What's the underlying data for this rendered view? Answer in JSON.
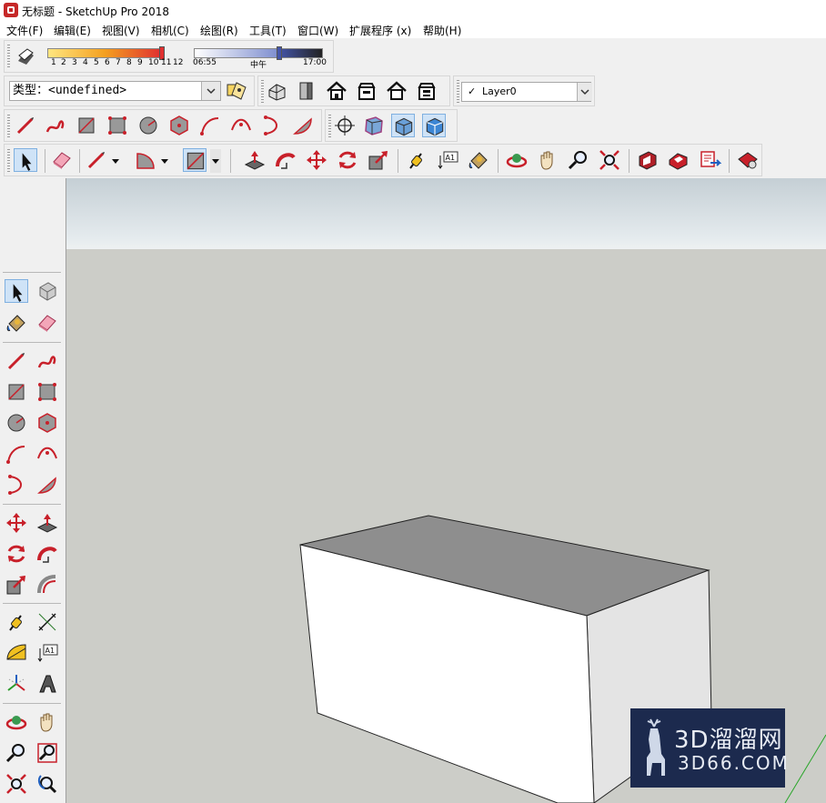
{
  "window": {
    "title": "无标题 - SketchUp Pro 2018"
  },
  "menu": [
    "文件(F)",
    "编辑(E)",
    "视图(V)",
    "相机(C)",
    "绘图(R)",
    "工具(T)",
    "窗口(W)",
    "扩展程序 (x)",
    "帮助(H)"
  ],
  "shadows": {
    "month_ticks": [
      "1",
      "2",
      "3",
      "4",
      "5",
      "6",
      "7",
      "8",
      "9",
      "10",
      "11",
      "12"
    ],
    "time_start": "06:55",
    "time_mid": "中午",
    "time_end": "17:00",
    "colors": {
      "month_gradient_start": "#ffe680",
      "month_gradient_end": "#e03030",
      "time_gradient_start": "#ffffff",
      "time_gradient_end": "#4455aa"
    }
  },
  "entity_info": {
    "label": "类型：",
    "value": "<undefined>"
  },
  "layer": {
    "check": "✓",
    "current": "Layer0"
  },
  "views_toolbar": [
    "iso-view-icon",
    "top-view-icon",
    "front-view-icon",
    "right-view-icon",
    "back-view-icon",
    "left-view-icon"
  ],
  "styles_toolbar": [
    "xray-icon",
    "back-edges-icon",
    "wireframe-icon",
    "hidden-line-icon"
  ],
  "watermark": {
    "brand": "3D溜溜网",
    "url": "3D66.COM"
  },
  "colors": {
    "viewport": "#cccdc8",
    "box_front": "#ffffff",
    "box_top": "#8e8e8e",
    "box_side": "#e3e3e3",
    "accent_red": "#c8202a",
    "watermark_bg": "#1c2a4e"
  }
}
